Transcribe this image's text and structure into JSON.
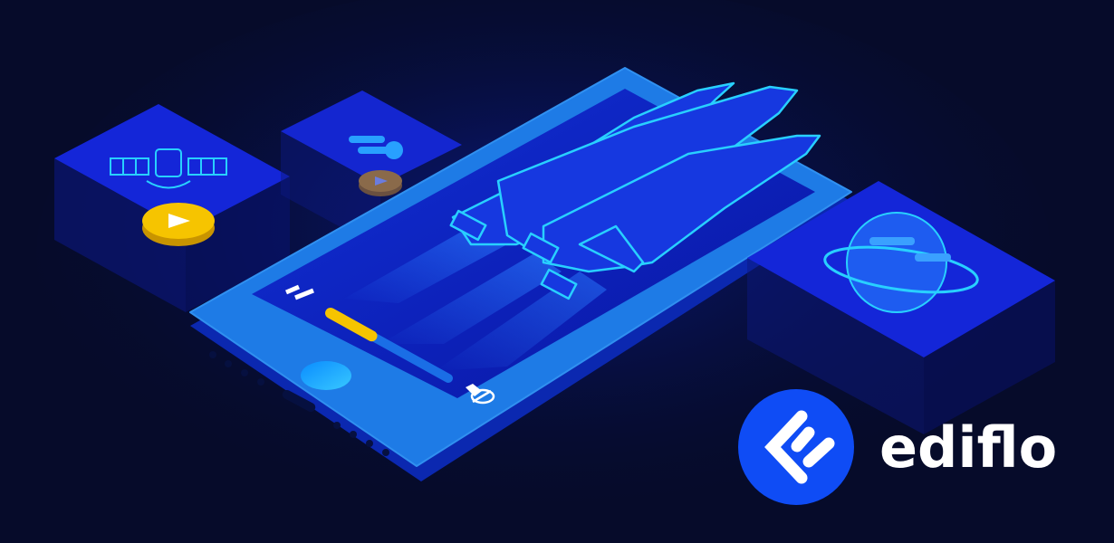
{
  "brand": {
    "name": "ediflo",
    "logo_icon": "ediflo-logo-mark",
    "color": "#0f4cf5"
  },
  "player": {
    "progress_percent": 35,
    "pause_icon": "pause-icon",
    "volume_icon": "mute-speaker-icon",
    "progress_color": "#f6c400"
  },
  "cards": [
    {
      "icon": "satellite-icon",
      "button": "play-icon",
      "button_color": "#f6c400"
    },
    {
      "icon": "comet-icon",
      "button": "play-icon",
      "button_color": "#8a6a4a"
    },
    {
      "icon": "planet-ring-icon"
    }
  ],
  "colors": {
    "background": "#060b2a",
    "phone": "#1e7be6",
    "screen": "#0a1fc0",
    "outline": "#28d0ff"
  }
}
